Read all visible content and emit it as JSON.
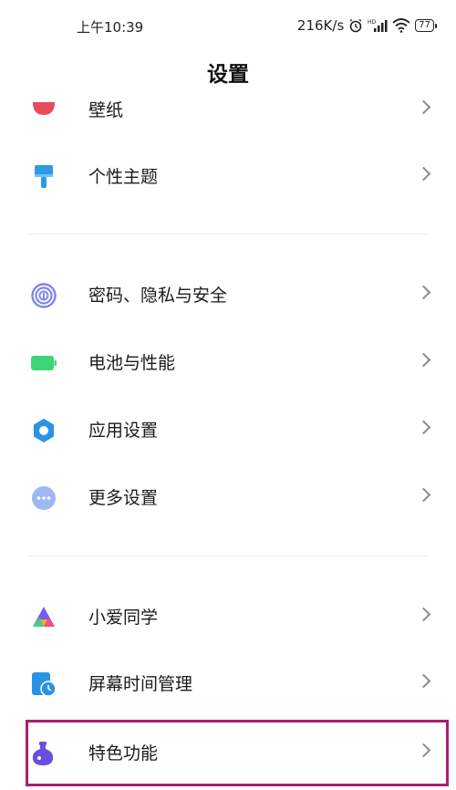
{
  "status_bar": {
    "time": "上午10:39",
    "network_speed": "216K/s",
    "battery": "77",
    "icons": [
      "alarm-icon",
      "hd-signal-icon",
      "wifi-icon",
      "battery-icon"
    ]
  },
  "header": {
    "title": "设置"
  },
  "groups": [
    {
      "items": [
        {
          "label": "壁纸",
          "icon": "wallpaper-icon",
          "color": "#e8495b"
        },
        {
          "label": "个性主题",
          "icon": "theme-brush-icon",
          "color": "#2b9be6"
        }
      ]
    },
    {
      "items": [
        {
          "label": "密码、隐私与安全",
          "icon": "fingerprint-icon",
          "color": "#7d86e9"
        },
        {
          "label": "电池与性能",
          "icon": "battery-performance-icon",
          "color": "#3ed47c"
        },
        {
          "label": "应用设置",
          "icon": "app-settings-gear-icon",
          "color": "#2a93e6"
        },
        {
          "label": "更多设置",
          "icon": "more-dots-icon",
          "color": "#8aaef0"
        }
      ]
    },
    {
      "items": [
        {
          "label": "小爱同学",
          "icon": "xiaoai-assistant-icon",
          "color": "#7a5cf0"
        },
        {
          "label": "屏幕时间管理",
          "icon": "screen-time-icon",
          "color": "#2a93e6"
        },
        {
          "label": "特色功能",
          "icon": "flask-icon",
          "color": "#6b4de0"
        }
      ]
    }
  ],
  "highlighted_item": "特色功能"
}
